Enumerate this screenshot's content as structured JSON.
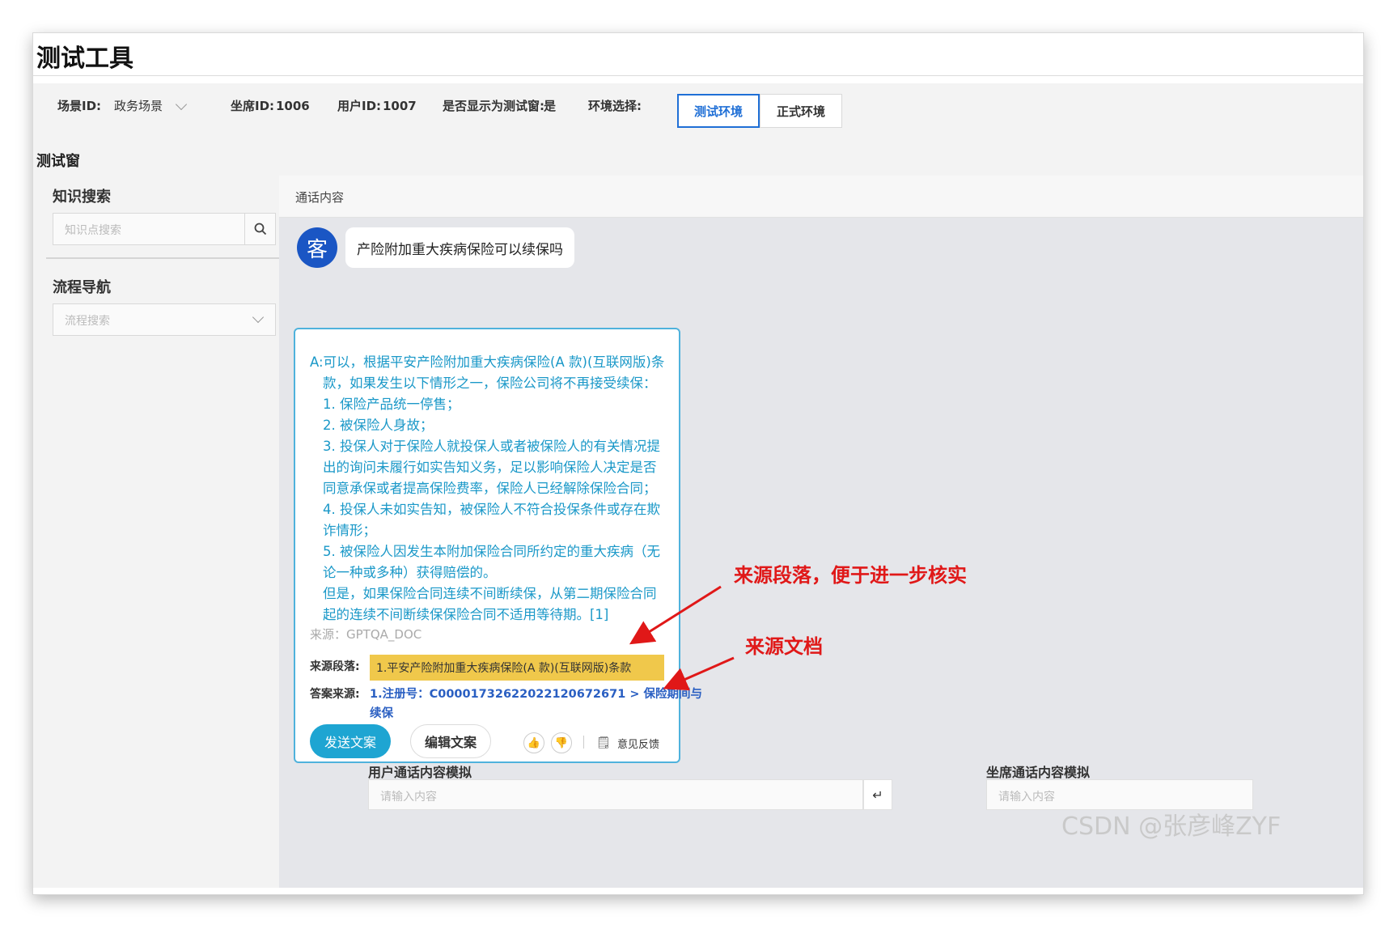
{
  "app": {
    "title": "测试工具"
  },
  "toolbar": {
    "scene_label": "场景ID:",
    "scene_value": "政务场景",
    "agent_label": "坐席ID:",
    "agent_value": "1006",
    "user_label": "用户ID:",
    "user_value": "1007",
    "show_label": "是否显示为测试窗:",
    "show_value": "是",
    "env_label": "环境选择:",
    "env_options": [
      "测试环境",
      "正式环境"
    ],
    "env_selected": "测试环境"
  },
  "test_window": {
    "title": "测试窗"
  },
  "left_panel": {
    "knowledge_title": "知识搜索",
    "knowledge_placeholder": "知识点搜索",
    "flow_title": "流程导航",
    "flow_placeholder": "流程搜索"
  },
  "conversation": {
    "header": "通话内容",
    "customer_avatar": "客",
    "customer_message": "产险附加重大疾病保险可以续保吗",
    "answer": {
      "lines": [
        "A:可以，根据平安产险附加重大疾病保险(A 款)(互联网版)条",
        "款，如果发生以下情形之一，保险公司将不再接受续保：",
        "1. 保险产品统一停售；",
        "2. 被保险人身故；",
        "3. 投保人对于保险人就投保人或者被保险人的有关情况提",
        "出的询问未履行如实告知义务，足以影响保险人决定是否",
        "同意承保或者提高保险费率，保险人已经解除保险合同；",
        "4. 投保人未如实告知，被保险人不符合投保条件或存在欺",
        "诈情形；",
        "5. 被保险人因发生本附加保险合同所约定的重大疾病（无",
        "论一种或多种）获得赔偿的。",
        "但是，如果保险合同连续不间断续保，从第二期保险合同",
        "起的连续不间断续保保险合同不适用等待期。[1]"
      ],
      "source": "来源：GPTQA_DOC",
      "para_label": "来源段落:",
      "para_value": "1.平安产险附加重大疾病保险(A 款)(互联网版)条款",
      "doc_label": "答案来源:",
      "doc_value_line1": "1.注册号：C00001732622022120672671 > 保险期间与",
      "doc_value_line2": "续保",
      "send_button": "发送文案",
      "edit_button": "编辑文案",
      "like_icon": "👍",
      "dislike_icon": "👎",
      "feedback_icon": "🗒",
      "feedback_label": "意见反馈"
    }
  },
  "simulation": {
    "user_label": "用户通话内容模拟",
    "user_placeholder": "请输入内容",
    "enter_icon": "↵",
    "agent_label": "坐席通话内容模拟",
    "agent_placeholder": "请输入内容"
  },
  "annotations": {
    "paragraph_note": "来源段落，便于进一步核实",
    "document_note": "来源文档",
    "arrow_color": "#e01818"
  },
  "watermark": "CSDN @张彦峰ZYF",
  "colors": {
    "accent": "#1f6fd6",
    "answer_text": "#1a98c8",
    "send_button": "#1ea5d2",
    "highlight": "#f0c84b"
  }
}
